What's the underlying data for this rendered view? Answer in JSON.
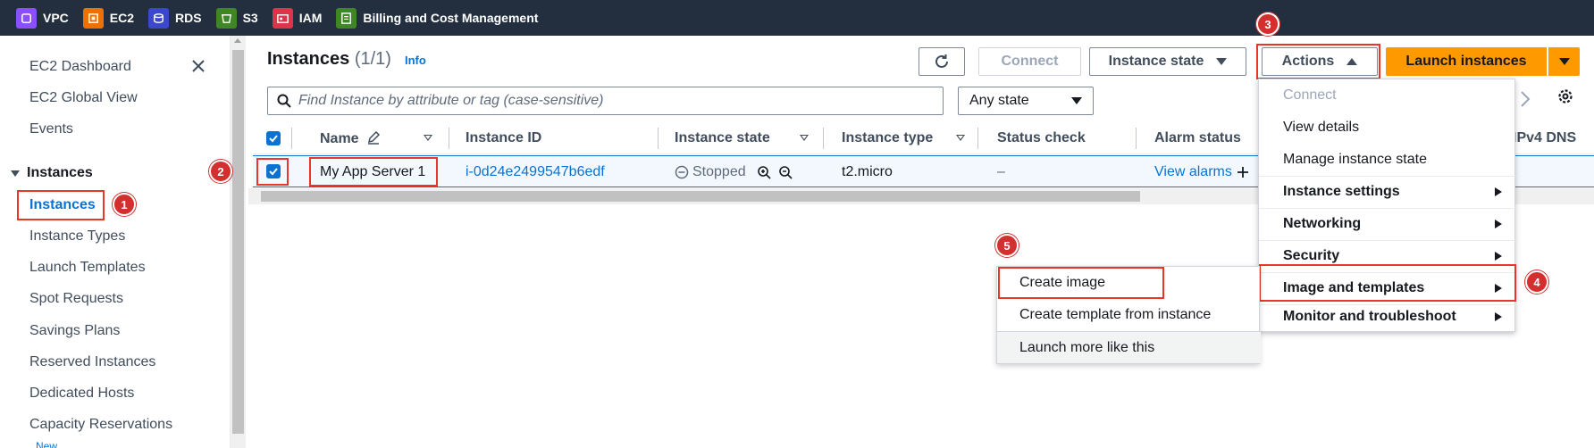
{
  "topbar": {
    "services": [
      {
        "label": "VPC",
        "icon": "vpc-icon",
        "color": "#8c4fff"
      },
      {
        "label": "EC2",
        "icon": "ec2-icon",
        "color": "#ed7100"
      },
      {
        "label": "RDS",
        "icon": "rds-icon",
        "color": "#3b48cc"
      },
      {
        "label": "S3",
        "icon": "s3-icon",
        "color": "#3f8624"
      },
      {
        "label": "IAM",
        "icon": "iam-icon",
        "color": "#dd344c"
      },
      {
        "label": "Billing and Cost Management",
        "icon": "billing-icon",
        "color": "#3f8624"
      }
    ]
  },
  "sidebar": {
    "items": [
      "EC2 Dashboard",
      "EC2 Global View",
      "Events"
    ],
    "section": "Instances",
    "active": "Instances",
    "sub_items": [
      "Instance Types",
      "Launch Templates",
      "Spot Requests",
      "Savings Plans",
      "Reserved Instances",
      "Dedicated Hosts",
      "Capacity Reservations"
    ],
    "new_badge": "New"
  },
  "markers": [
    "1",
    "2",
    "3",
    "4",
    "5"
  ],
  "header": {
    "title": "Instances",
    "count": "(1/1)",
    "info": "Info",
    "connect": "Connect",
    "instance_state": "Instance state",
    "actions": "Actions",
    "launch": "Launch instances"
  },
  "search": {
    "placeholder": "Find Instance by attribute or tag (case-sensitive)",
    "state_filter": "Any state"
  },
  "table": {
    "columns": [
      "Name",
      "Instance ID",
      "Instance state",
      "Instance type",
      "Status check",
      "Alarm status",
      "IPv4 DNS"
    ],
    "row": {
      "name": "My App Server 1",
      "id": "i-0d24e2499547b6edf",
      "state": "Stopped",
      "type": "t2.micro",
      "status_check": "–",
      "alarm": "View alarms"
    }
  },
  "actions_menu": {
    "items": [
      "Connect",
      "View details",
      "Manage instance state",
      "Instance settings",
      "Networking",
      "Security",
      "Image and templates",
      "Monitor and troubleshoot"
    ]
  },
  "submenu": {
    "items": [
      "Create image",
      "Create template from instance",
      "Launch more like this"
    ]
  },
  "colors": {
    "accent": "#0972d3",
    "primary_button": "#ff9900",
    "highlight": "#e8362b",
    "topbar": "#232f3e"
  }
}
